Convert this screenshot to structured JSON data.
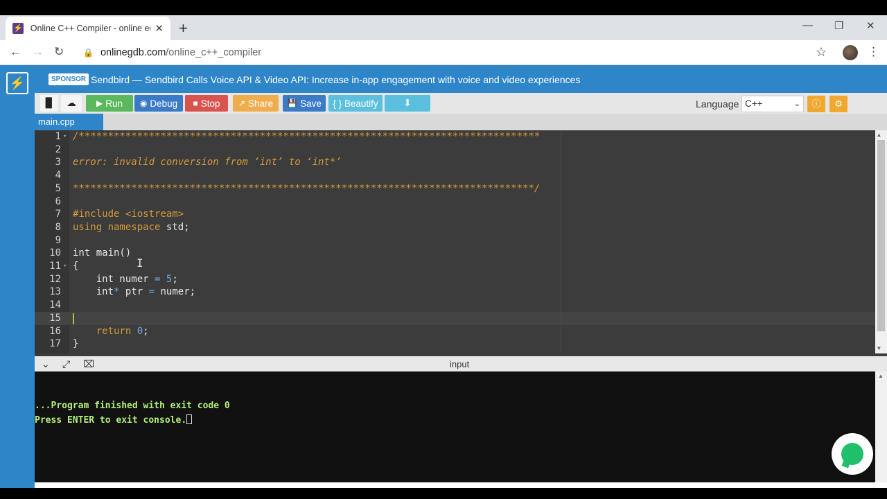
{
  "browser": {
    "tab_title": "Online C++ Compiler - online ed",
    "tab_close": "✕",
    "new_tab": "+",
    "url_host": "onlinegdb.com",
    "url_path": "/online_c++_compiler",
    "minimize": "—",
    "restore": "❐",
    "close": "✕"
  },
  "sponsor": {
    "badge": "SPONSOR",
    "text": "Sendbird — Sendbird Calls Voice API & Video API: Increase in-app engagement with voice and video experiences"
  },
  "toolbar": {
    "run": "Run",
    "debug": "Debug",
    "stop": "Stop",
    "share": "Share",
    "save": "Save",
    "beautify": "{ } Beautify",
    "language_label": "Language",
    "language_value": "C++"
  },
  "file_tab": "main.cpp",
  "editor": {
    "line_numbers": [
      "1",
      "2",
      "3",
      "4",
      "5",
      "6",
      "7",
      "8",
      "9",
      "10",
      "11",
      "12",
      "13",
      "14",
      "15",
      "16",
      "17"
    ],
    "comment_top": "/*******************************************************************************",
    "comment_error": "error: invalid conversion from ‘int’ to ‘int*’",
    "comment_bottom": "*******************************************************************************/",
    "include_kw": "#include",
    "include_hdr": "<iostream>",
    "using_kw": "using namespace",
    "using_rest": " std;",
    "main_decl": "int main()",
    "brace_open": "{",
    "l12_a": "    int numer ",
    "l12_eq": "=",
    "l12_sp": " ",
    "l12_num": "5",
    "l12_end": ";",
    "l13_a": "    int",
    "l13_star": "*",
    "l13_b": " ptr ",
    "l13_eq": "=",
    "l13_c": " numer;",
    "l16_indent": "    ",
    "l16_kw": "return",
    "l16_sp": " ",
    "l16_num": "0",
    "l16_end": ";",
    "brace_close": "}"
  },
  "io": {
    "title": "input",
    "console_line1": "...Program finished with exit code 0",
    "console_line2": "Press ENTER to exit console."
  },
  "colors": {
    "accent_blue": "#2e86c9",
    "run_green": "#5cb85c",
    "stop_red": "#d9534f",
    "share_orange": "#f0ad4e",
    "beautify_light_blue": "#5bc0de",
    "comment_orange": "#d49a3a",
    "console_green": "#b6ef7a"
  }
}
